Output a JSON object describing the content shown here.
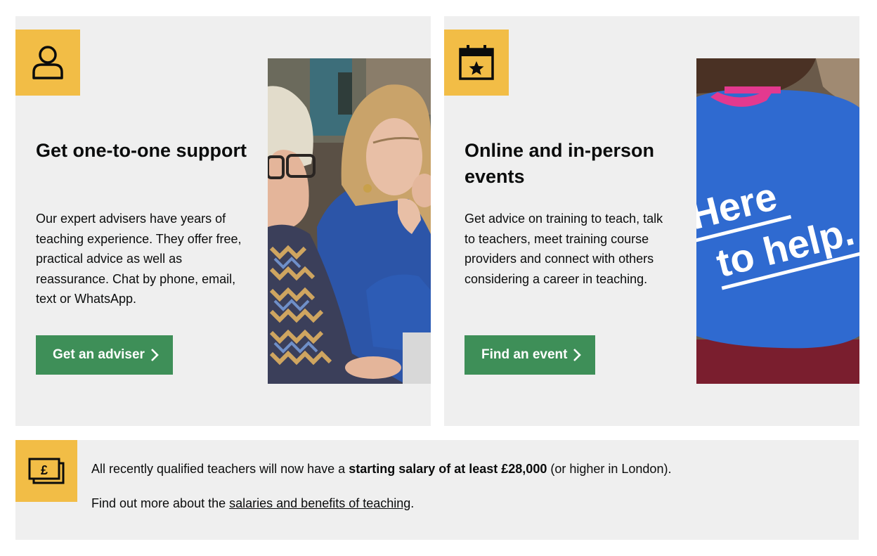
{
  "adviser_card": {
    "icon": "person-icon",
    "title": "Get one-to-one support",
    "body": "Our expert advisers have years of teaching experience. They offer free, practical advice as well as reassurance. Chat by phone, email, text or WhatsApp.",
    "button_label": "Get an adviser"
  },
  "events_card": {
    "icon": "calendar-star-icon",
    "title": "Online and in-person events",
    "body": "Get advice on training to teach, talk to teachers, meet training course providers and connect with others considering a career in teaching.",
    "button_label": "Find an event",
    "photo_text_line1": "Here",
    "photo_text_line2": "to help."
  },
  "salary_banner": {
    "icon": "pound-notes-icon",
    "icon_symbol": "£",
    "text_before": "All recently qualified teachers will now have a ",
    "text_bold": "starting salary of at least £28,000",
    "text_after": " (or higher in London).",
    "line2_before": "Find out more about the ",
    "link_text": "salaries and benefits of teaching",
    "line2_after": "."
  },
  "colors": {
    "accent_yellow": "#f2bd46",
    "button_green": "#3e8f58",
    "card_background": "#efefef"
  }
}
